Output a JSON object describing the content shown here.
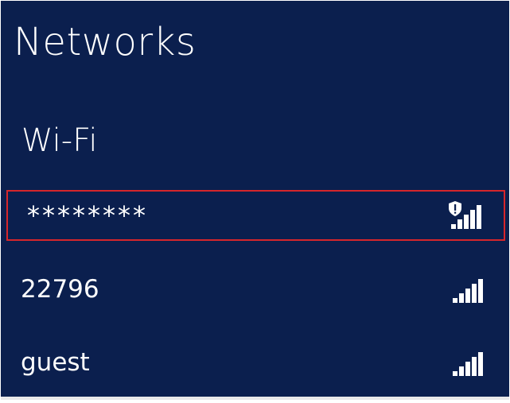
{
  "panel": {
    "title": "Networks",
    "section_label": "Wi-Fi"
  },
  "networks": [
    {
      "name": "********",
      "selected": true,
      "secured_warning": true,
      "signal_level": 5,
      "signal_icon": "wifi-signal-warning-icon"
    },
    {
      "name": "22796",
      "selected": false,
      "secured_warning": false,
      "signal_level": 5,
      "signal_icon": "wifi-signal-icon"
    },
    {
      "name": "guest",
      "selected": false,
      "secured_warning": false,
      "signal_level": 5,
      "signal_icon": "wifi-signal-icon"
    }
  ],
  "colors": {
    "background": "#0b1f4e",
    "text": "#ffffff",
    "selection_outline": "#d6262b"
  }
}
